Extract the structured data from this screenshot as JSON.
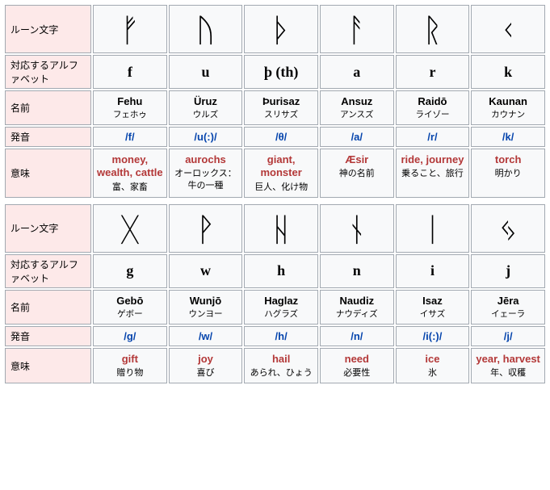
{
  "headers": {
    "rune": "ルーン文字",
    "letter": "対応するアルファベット",
    "name": "名前",
    "pron": "発音",
    "meaning": "意味"
  },
  "rows": [
    [
      {
        "rune": "ᚠ",
        "letter": "f",
        "name_en": "Fehu",
        "name_jp": "フェホゥ",
        "pron": "/f/",
        "mean_en": "money, wealth, cattle",
        "mean_jp": "富、家畜"
      },
      {
        "rune": "ᚢ",
        "letter": "u",
        "name_en": "Üruz",
        "name_jp": "ウルズ",
        "pron": "/u(:)/",
        "mean_en": "aurochs",
        "mean_jp": "オーロックス：牛の一種"
      },
      {
        "rune": "ᚦ",
        "letter": "þ (th)",
        "name_en": "Þurisaz",
        "name_jp": "スリサズ",
        "pron": "/θ/",
        "mean_en": "giant, monster",
        "mean_jp": "巨人、化け物"
      },
      {
        "rune": "ᚨ",
        "letter": "a",
        "name_en": "Ansuz",
        "name_jp": "アンスズ",
        "pron": "/a/",
        "mean_en": "Æsir",
        "mean_jp": "神の名前"
      },
      {
        "rune": "ᚱ",
        "letter": "r",
        "name_en": "Raidō",
        "name_jp": "ライゾー",
        "pron": "/r/",
        "mean_en": "ride, journey",
        "mean_jp": "乗ること、旅行"
      },
      {
        "rune": "ᚲ",
        "letter": "k",
        "name_en": "Kaunan",
        "name_jp": "カウナン",
        "pron": "/k/",
        "mean_en": "torch",
        "mean_jp": "明かり"
      }
    ],
    [
      {
        "rune": "ᚷ",
        "letter": "g",
        "name_en": "Gebō",
        "name_jp": "ゲボー",
        "pron": "/g/",
        "mean_en": "gift",
        "mean_jp": "贈り物"
      },
      {
        "rune": "ᚹ",
        "letter": "w",
        "name_en": "Wunjō",
        "name_jp": "ウンヨー",
        "pron": "/w/",
        "mean_en": "joy",
        "mean_jp": "喜び"
      },
      {
        "rune": "ᚺ",
        "letter": "h",
        "name_en": "Haglaz",
        "name_jp": "ハグラズ",
        "pron": "/h/",
        "mean_en": "hail",
        "mean_jp": "あられ、ひょう"
      },
      {
        "rune": "ᚾ",
        "letter": "n",
        "name_en": "Naudiz",
        "name_jp": "ナウディズ",
        "pron": "/n/",
        "mean_en": "need",
        "mean_jp": "必要性"
      },
      {
        "rune": "ᛁ",
        "letter": "i",
        "name_en": "Isaz",
        "name_jp": "イサズ",
        "pron": "/i(:)/",
        "mean_en": "ice",
        "mean_jp": "氷"
      },
      {
        "rune": "ᛃ",
        "letter": "j",
        "name_en": "Jēra",
        "name_jp": "イェーラ",
        "pron": "/j/",
        "mean_en": "year, harvest",
        "mean_jp": "年、収穫"
      }
    ]
  ]
}
